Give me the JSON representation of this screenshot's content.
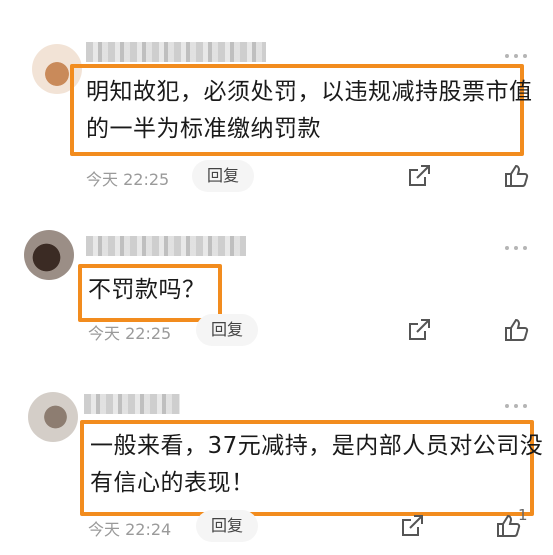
{
  "comments": [
    {
      "text_line1": "明知故犯，必须处罚，以违规减持股票市值",
      "text_line2": "的一半为标准缴纳罚款",
      "time": "今天 22:25",
      "reply_label": "回复",
      "likes": ""
    },
    {
      "text_line1": "不罚款吗？",
      "time": "今天 22:25",
      "reply_label": "回复",
      "likes": ""
    },
    {
      "text_line1": "一般来看，37元减持，是内部人员对公司没",
      "text_line2": "有信心的表现！",
      "time": "今天 22:24",
      "reply_label": "回复",
      "likes": "1"
    }
  ],
  "icons": {
    "more": "more-icon",
    "share": "share-icon",
    "like": "thumbs-up-icon"
  },
  "colors": {
    "highlight": "#f28c1e",
    "time": "#9a9a9a",
    "reply_bg": "#f5f5f5"
  }
}
